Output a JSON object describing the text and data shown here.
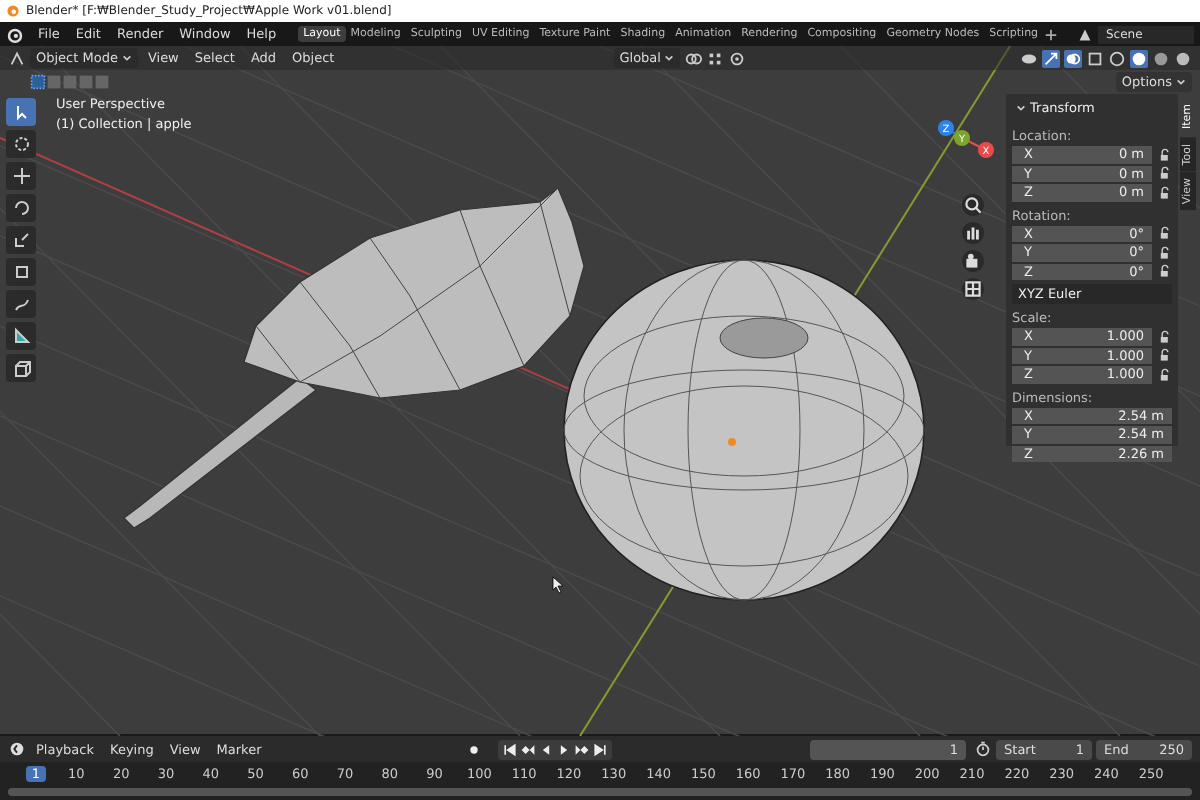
{
  "window": {
    "title": "Blender* [F:₩Blender_Study_Project₩Apple Work v01.blend]"
  },
  "menu": [
    "File",
    "Edit",
    "Render",
    "Window",
    "Help"
  ],
  "workspaces": [
    {
      "label": "Layout",
      "selected": true
    },
    {
      "label": "Modeling",
      "selected": false
    },
    {
      "label": "Sculpting",
      "selected": false
    },
    {
      "label": "UV Editing",
      "selected": false
    },
    {
      "label": "Texture Paint",
      "selected": false
    },
    {
      "label": "Shading",
      "selected": false
    },
    {
      "label": "Animation",
      "selected": false
    },
    {
      "label": "Rendering",
      "selected": false
    },
    {
      "label": "Compositing",
      "selected": false
    },
    {
      "label": "Geometry Nodes",
      "selected": false
    },
    {
      "label": "Scripting",
      "selected": false
    }
  ],
  "scene": "Scene",
  "header": {
    "mode": "Object Mode",
    "menus": [
      "View",
      "Select",
      "Add",
      "Object"
    ],
    "orientation": "Global",
    "options": "Options"
  },
  "viewport": {
    "perspective": "User Perspective",
    "collection": "(1) Collection | apple",
    "gizmo": [
      {
        "axis": "Z",
        "color": "#2f83e6"
      },
      {
        "axis": "Y",
        "color": "#7da42b"
      },
      {
        "axis": "X",
        "color": "#e84b4b"
      }
    ]
  },
  "tools": [
    {
      "kind": "select",
      "selected": true
    },
    {
      "kind": "cursor",
      "selected": false
    },
    {
      "kind": "move",
      "selected": false
    },
    {
      "kind": "rotate",
      "selected": false
    },
    {
      "kind": "scale",
      "selected": false
    },
    {
      "kind": "transform",
      "selected": false
    },
    {
      "kind": "annotate",
      "selected": false
    },
    {
      "kind": "measure",
      "selected": false
    },
    {
      "kind": "add-cube",
      "selected": false
    }
  ],
  "sidebar": {
    "tabs": [
      {
        "label": "Item",
        "selected": true
      },
      {
        "label": "Tool",
        "selected": false
      },
      {
        "label": "View",
        "selected": false
      }
    ],
    "panel": "Transform",
    "groups": [
      {
        "label": "Location:",
        "lock": true,
        "fields": [
          {
            "axis": "X",
            "value": "0 m"
          },
          {
            "axis": "Y",
            "value": "0 m"
          },
          {
            "axis": "Z",
            "value": "0 m"
          }
        ]
      },
      {
        "label": "Rotation:",
        "lock": true,
        "fields": [
          {
            "axis": "X",
            "value": "0°"
          },
          {
            "axis": "Y",
            "value": "0°"
          },
          {
            "axis": "Z",
            "value": "0°"
          }
        ],
        "mode": "XYZ Euler"
      },
      {
        "label": "Scale:",
        "lock": true,
        "fields": [
          {
            "axis": "X",
            "value": "1.000"
          },
          {
            "axis": "Y",
            "value": "1.000"
          },
          {
            "axis": "Z",
            "value": "1.000"
          }
        ]
      },
      {
        "label": "Dimensions:",
        "lock": false,
        "fields": [
          {
            "axis": "X",
            "value": "2.54 m"
          },
          {
            "axis": "Y",
            "value": "2.54 m"
          },
          {
            "axis": "Z",
            "value": "2.26 m"
          }
        ]
      }
    ]
  },
  "timeline": {
    "menus": [
      "Playback",
      "Keying",
      "View",
      "Marker"
    ],
    "current_frame": "1",
    "start_label": "Start",
    "start": "1",
    "end_label": "End",
    "end": "250",
    "ruler": [
      "1",
      "10",
      "20",
      "30",
      "40",
      "50",
      "60",
      "70",
      "80",
      "90",
      "100",
      "110",
      "120",
      "130",
      "140",
      "150",
      "160",
      "170",
      "180",
      "190",
      "200",
      "210",
      "220",
      "230",
      "240",
      "250"
    ]
  }
}
